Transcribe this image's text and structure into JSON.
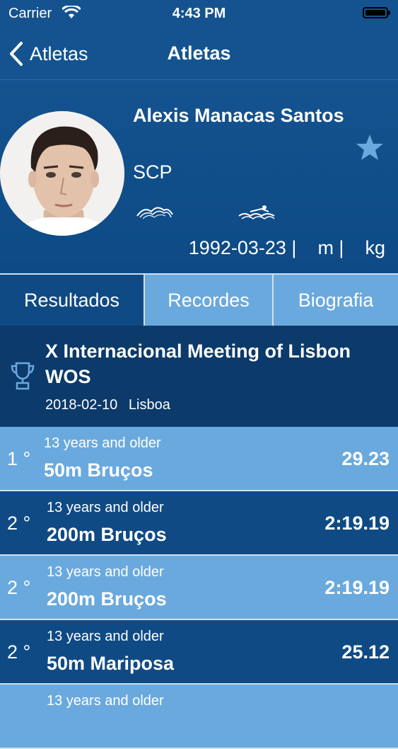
{
  "status_bar": {
    "carrier": "Carrier",
    "time": "4:43 PM"
  },
  "navbar": {
    "back_label": "Atletas",
    "title": "Atletas"
  },
  "athlete": {
    "name": "Alexis Manacas Santos",
    "club": "SCP",
    "birthdate": "1992-03-23 |",
    "height": "m |",
    "weight": "kg",
    "favorite": false
  },
  "tabs": [
    {
      "label": "Resultados",
      "active": true
    },
    {
      "label": "Recordes",
      "active": false
    },
    {
      "label": "Biografia",
      "active": false
    }
  ],
  "meet": {
    "name": "X Internacional Meeting of Lisbon WOS",
    "date": "2018-02-10",
    "location": "Lisboa"
  },
  "results": [
    {
      "position": "1 °",
      "category": "13 years and older",
      "event": "50m Bruços",
      "time": "29.23"
    },
    {
      "position": "2 °",
      "category": "13 years and older",
      "event": "200m Bruços",
      "time": "2:19.19"
    },
    {
      "position": "2 °",
      "category": "13 years and older",
      "event": "200m Bruços",
      "time": "2:19.19"
    },
    {
      "position": "2 °",
      "category": "13 years and older",
      "event": "50m Mariposa",
      "time": "25.12"
    },
    {
      "position": "",
      "category": "13 years and older",
      "event": "",
      "time": ""
    }
  ],
  "colors": {
    "primary": "#0f4a84",
    "accent_light": "#6aa9dd",
    "meet_header": "#0b3a6b"
  }
}
